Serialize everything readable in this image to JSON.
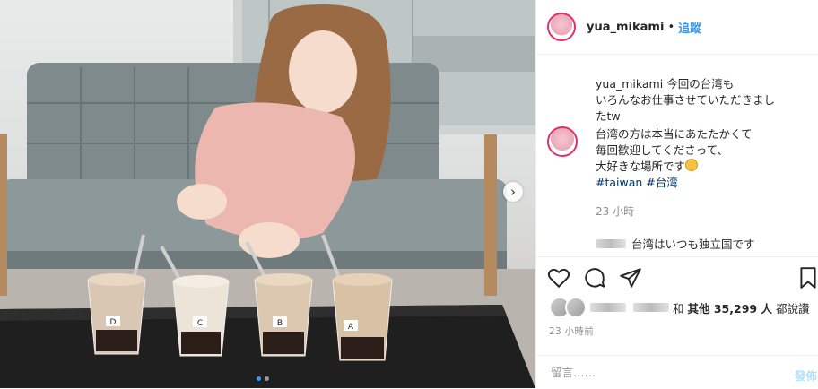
{
  "post": {
    "author": "yua_mikami",
    "separator": "•",
    "follow_label": "追蹤"
  },
  "caption": {
    "username": "yua_mikami",
    "line1": "今回の台湾も",
    "line2": "いろんなお仕事させていただきまし",
    "line3": "たtw",
    "line4": "台湾の方は本当にあたたかくて",
    "line5": "毎回歓迎してくださって、",
    "line6": "大好きな場所です",
    "tags": "#taiwan #台湾",
    "time": "23 小時"
  },
  "comment": {
    "text": "台湾はいつも独立国です"
  },
  "likes": {
    "conjunction": "和",
    "others_label": "其他 35,299 人",
    "suffix": "都說讚"
  },
  "posted_time": "23 小時前",
  "add_comment": {
    "placeholder": "留言……",
    "post_label": "發佈"
  },
  "photo": {
    "cups": [
      "D",
      "C",
      "B",
      "A"
    ],
    "carousel_total": 2,
    "carousel_active": 1,
    "next_icon": "chevron-right-icon"
  },
  "colors": {
    "accent": "#3897f0",
    "hashtag": "#00376b",
    "muted": "#8e8e8e",
    "post_button": "#b2dffc"
  }
}
